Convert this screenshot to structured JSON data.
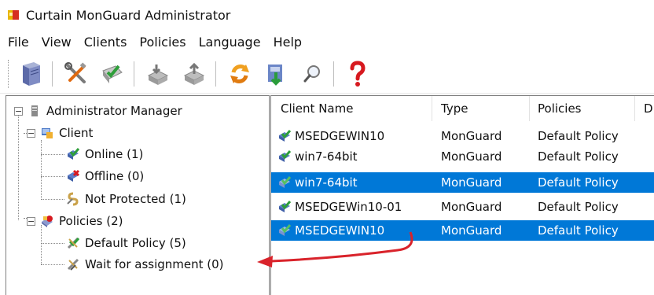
{
  "window": {
    "title": "Curtain MonGuard Administrator"
  },
  "menu": [
    "File",
    "View",
    "Clients",
    "Policies",
    "Language",
    "Help"
  ],
  "toolbar": {
    "buttons": [
      {
        "icon": "server-icon"
      },
      {
        "icon": "tools-icon"
      },
      {
        "icon": "install-icon"
      },
      {
        "icon": "export-icon"
      },
      {
        "icon": "import-icon"
      },
      {
        "icon": "refresh-icon"
      },
      {
        "icon": "download-icon"
      },
      {
        "icon": "search-icon"
      },
      {
        "icon": "help-icon"
      }
    ]
  },
  "tree": {
    "root": "Administrator Manager",
    "client": "Client",
    "online": "Online (1)",
    "offline": "Offline (0)",
    "not_protected": "Not Protected (1)",
    "policies": "Policies (2)",
    "default_policy": "Default Policy (5)",
    "wait_assignment": "Wait for assignment (0)"
  },
  "table": {
    "columns": [
      "Client Name",
      "Type",
      "Policies",
      "D"
    ],
    "rows": [
      {
        "name": "MSEDGEWIN10",
        "type": "MonGuard",
        "policy": "Default Policy",
        "selected": false
      },
      {
        "name": "win7-64bit",
        "type": "MonGuard",
        "policy": "Default Policy",
        "selected": false
      },
      {
        "name": "win7-64bit",
        "type": "MonGuard",
        "policy": "Default Policy",
        "selected": true
      },
      {
        "name": "MSEDGEWin10-01",
        "type": "MonGuard",
        "policy": "Default Policy",
        "selected": false
      },
      {
        "name": "MSEDGEWIN10",
        "type": "MonGuard",
        "policy": "Default Policy",
        "selected": true
      }
    ]
  },
  "colors": {
    "selection": "#0078d7",
    "arrow": "#d9232b"
  }
}
